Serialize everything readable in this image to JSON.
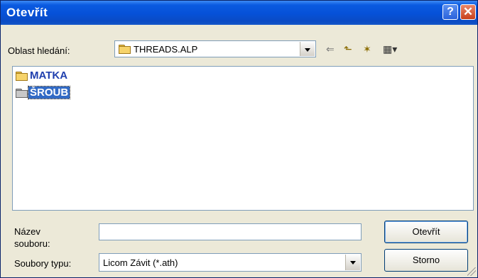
{
  "window": {
    "title": "Otevřít",
    "help_label": "?",
    "close_label": "✕"
  },
  "lookin": {
    "label": "Oblast hledání:",
    "value": "THREADS.ALP"
  },
  "toolbar": {
    "back_glyph": "⇐",
    "up_glyph": "⬑",
    "new_folder_glyph": "✶",
    "view_glyph": "▦▾"
  },
  "files": [
    {
      "name": "MATKA",
      "icon": "folder-icon",
      "selected": false
    },
    {
      "name": "ŠROUB",
      "icon": "folder-icon",
      "selected": true
    }
  ],
  "filename": {
    "label_line1": "Název",
    "label_line2": "souboru:",
    "value": ""
  },
  "filetype": {
    "label": "Soubory typu:",
    "value": "Licom Závit (*.ath)"
  },
  "buttons": {
    "open": "Otevřít",
    "cancel": "Storno"
  }
}
